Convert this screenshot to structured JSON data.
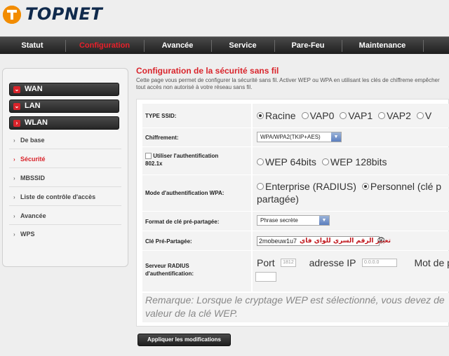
{
  "brand": {
    "name": "TOPNET",
    "accent": "#f28c00",
    "red": "#d9242b"
  },
  "nav": {
    "items": [
      "Statut",
      "Configuration",
      "Avancée",
      "Service",
      "Pare-Feu",
      "Maintenance"
    ],
    "active": "Configuration"
  },
  "sidebar": {
    "main": [
      "WAN",
      "LAN",
      "WLAN"
    ],
    "sub": [
      "De base",
      "Sécurité",
      "MBSSID",
      "Liste de contrôle d'accès",
      "Avancée",
      "WPS"
    ],
    "active_sub": "Sécurité"
  },
  "page": {
    "title": "Configuration de la sécurité sans fil",
    "description": "Cette page vous permet de configurer la sécurité sans fil. Activer WEP ou WPA en utilisant les clés de chiffreme empêcher tout accès non autorisé à votre réseau sans fil."
  },
  "form": {
    "ssid_type": {
      "label": "TYPE SSID:",
      "options": [
        "Racine",
        "VAP0",
        "VAP1",
        "VAP2",
        "V"
      ],
      "selected": "Racine"
    },
    "encryption": {
      "label": "Chiffrement:",
      "value": "WPA/WPA2(TKIP+AES)"
    },
    "auth_8021x": {
      "label": "Utiliser l'authentification 802.1x",
      "label_line1": "Utiliser l'authentification",
      "label_line2": "802.1x",
      "checked": false,
      "options": [
        "WEP 64bits",
        "WEP 128bits"
      ]
    },
    "wpa_auth_mode": {
      "label": "Mode d'authentification WPA:",
      "options": [
        "Enterprise (RADIUS)",
        "Personnel (clé p"
      ],
      "options_tail": "partagée)",
      "selected": "Personnel (clé p"
    },
    "psk_format": {
      "label": "Format de clé pré-partagée:",
      "value": "Phrase secrète"
    },
    "psk": {
      "label": "Clé Pré-Partagée:",
      "value": "2mobeuw1u7",
      "annotation": "تغيير الرقم السري للواي فاي"
    },
    "radius": {
      "label_line1": "Serveur RADIUS",
      "label_line2": "d'authentification:",
      "port_label": "Port",
      "port_value": "1812",
      "ip_label": "adresse IP",
      "ip_value": "0.0.0.0",
      "pwd_label": "Mot de p"
    },
    "remark_line1": "Remarque: Lorsque le cryptage WEP est sélectionné, vous devez de",
    "remark_line2": "valeur de la clé WEP."
  },
  "actions": {
    "apply": "Appliquer les modifications"
  }
}
